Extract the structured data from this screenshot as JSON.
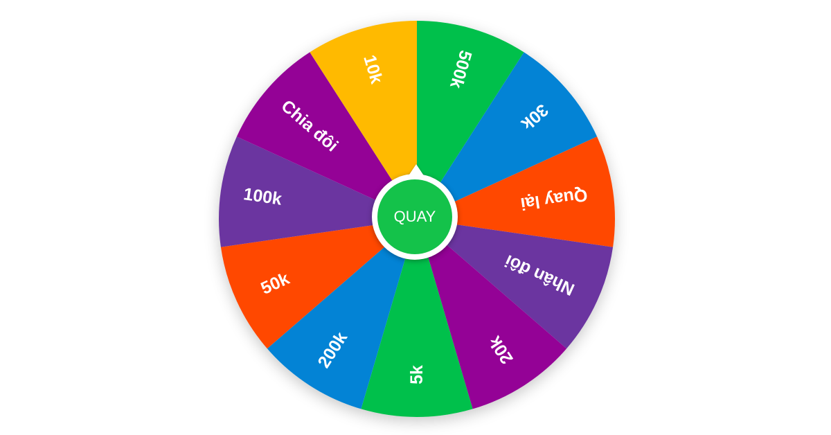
{
  "wheel": {
    "segments": [
      {
        "label": "500k",
        "color": "#00c04b"
      },
      {
        "label": "30k",
        "color": "#0383d5"
      },
      {
        "label": "Quay lại",
        "color": "#ff4800"
      },
      {
        "label": "Nhân đôi",
        "color": "#6b35a0"
      },
      {
        "label": "20k",
        "color": "#940296"
      },
      {
        "label": "5k",
        "color": "#00c04b"
      },
      {
        "label": "200k",
        "color": "#0383d5"
      },
      {
        "label": "50k",
        "color": "#ff4800"
      },
      {
        "label": "100k",
        "color": "#6b35a0"
      },
      {
        "label": "Chia đôi",
        "color": "#940296"
      },
      {
        "label": "10k",
        "color": "#ffba00"
      }
    ]
  },
  "spin_button": {
    "label": "QUAY",
    "color": "#14c24a"
  }
}
